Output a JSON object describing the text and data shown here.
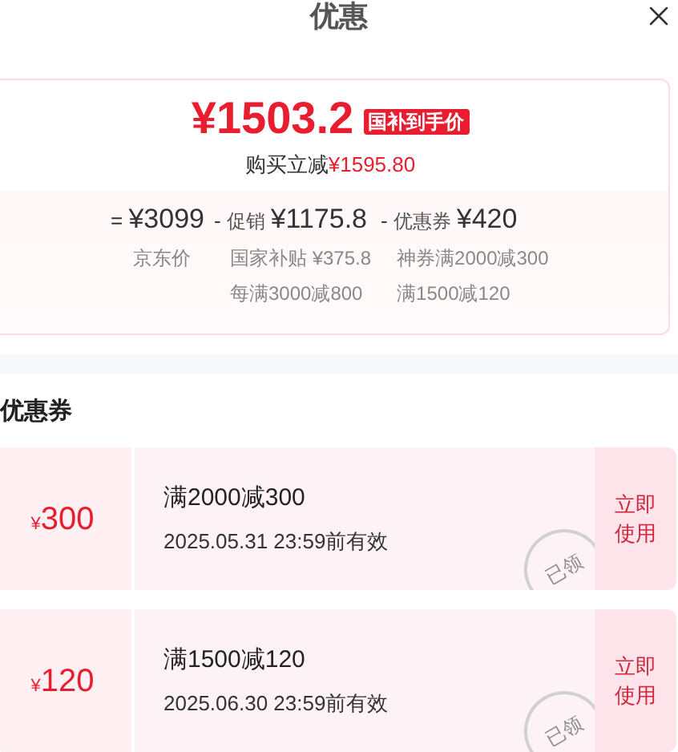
{
  "header": {
    "title": "优惠"
  },
  "summary": {
    "price": "¥1503.2",
    "badge": "国补到手价",
    "saving_label": "购买立减",
    "saving_amount": "¥1595.80"
  },
  "breakdown": [
    {
      "operator": "=",
      "amount": "¥3099",
      "details": [
        "京东价"
      ]
    },
    {
      "operator": "-",
      "label": "促销",
      "amount": "¥1175.8",
      "details": [
        "国家补贴 ¥375.8",
        "每满3000减800"
      ]
    },
    {
      "operator": "-",
      "label": "优惠券",
      "amount": "¥420",
      "details": [
        "神券满2000减300",
        "满1500减120"
      ]
    }
  ],
  "coupons_section": {
    "title": "优惠券",
    "coupons": [
      {
        "currency": "¥",
        "amount": "300",
        "condition": "满2000减300",
        "validity": "2025.05.31 23:59前有效",
        "action": "立即使用",
        "stamp": "已领"
      },
      {
        "currency": "¥",
        "amount": "120",
        "condition": "满1500减120",
        "validity": "2025.06.30 23:59前有效",
        "action": "立即使用",
        "stamp": "已领"
      }
    ]
  }
}
